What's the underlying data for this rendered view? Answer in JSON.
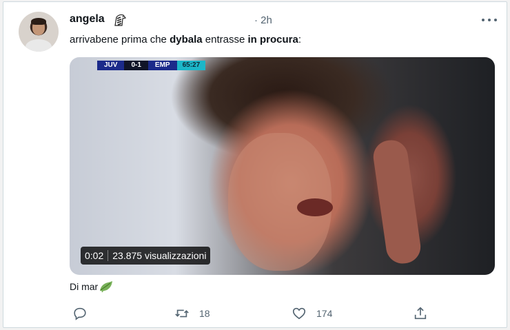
{
  "tweet": {
    "author_name": "angela",
    "time": "· 2h",
    "text_parts": [
      "arrivabene prima che ",
      "dybala",
      " entrasse ",
      "in procura",
      ":"
    ],
    "reply_line": "Di mar",
    "author_badge_icon": "zebra-icon",
    "reply_emoji_icon": "leaf-icon"
  },
  "media": {
    "score": {
      "home": "JUV",
      "result": "0-1",
      "away": "EMP",
      "clock": "65:27"
    },
    "duration": "0:02",
    "views": "23.875 visualizzazioni"
  },
  "actions": {
    "reply": {
      "icon": "reply-icon",
      "count": ""
    },
    "retweet": {
      "icon": "retweet-icon",
      "count": "18"
    },
    "like": {
      "icon": "heart-icon",
      "count": "174"
    },
    "share": {
      "icon": "share-icon",
      "count": ""
    }
  },
  "colors": {
    "text": "#0f1419",
    "secondary": "#536471",
    "border": "#cfd9de",
    "clock": "#1cb6c8",
    "team": "#1b2a8a"
  }
}
